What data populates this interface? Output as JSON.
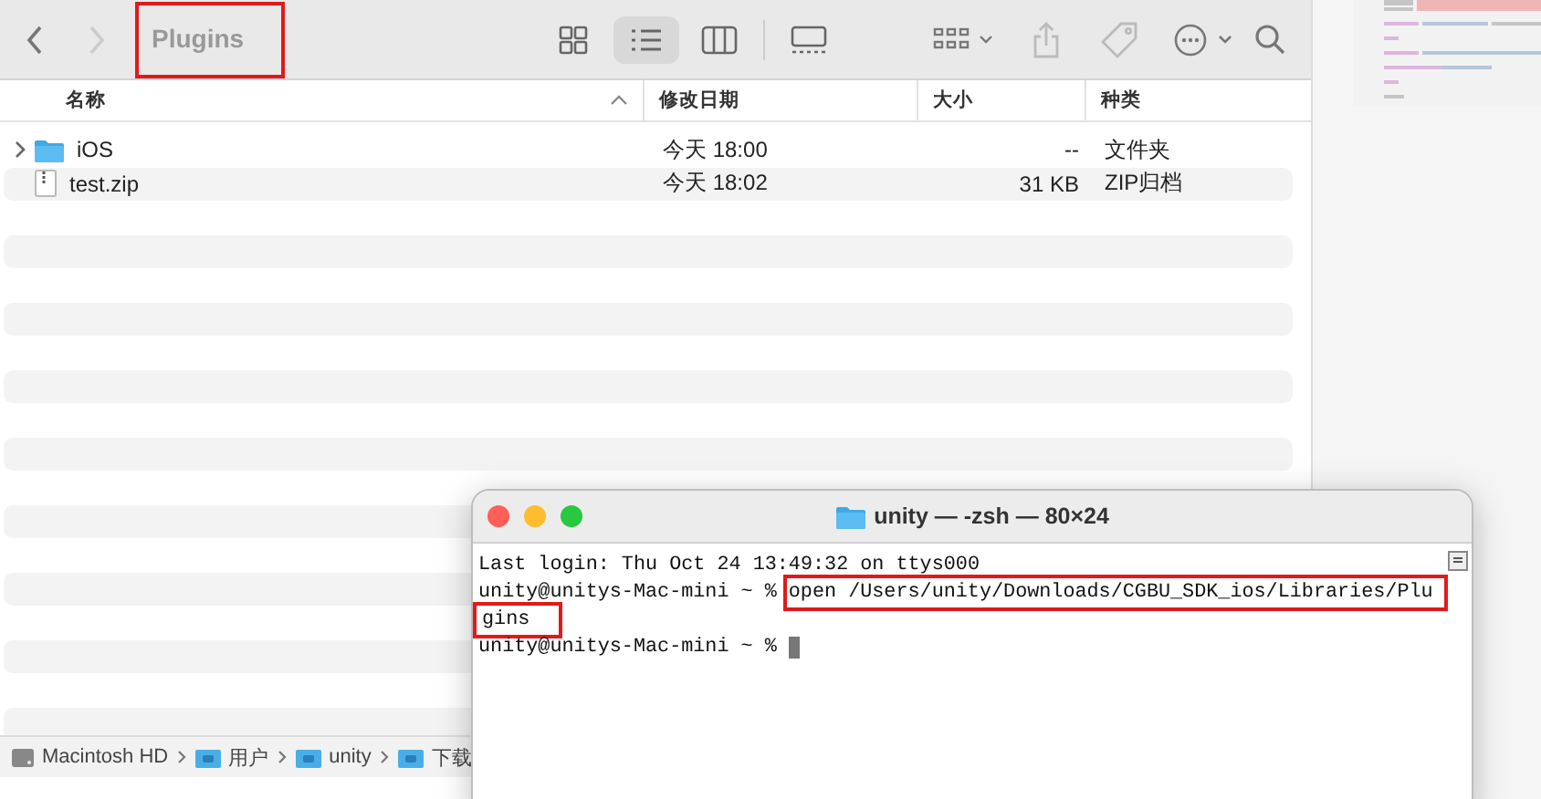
{
  "finder": {
    "title": "Plugins",
    "title_highlighted": true,
    "views": [
      {
        "kind": "grid",
        "selected": false
      },
      {
        "kind": "list",
        "selected": true
      },
      {
        "kind": "columns",
        "selected": false
      },
      {
        "kind": "gallery",
        "selected": false
      }
    ],
    "columns": [
      {
        "label": "名称",
        "sorted": true
      },
      {
        "label": "修改日期",
        "sorted": false
      },
      {
        "label": "大小",
        "sorted": false
      },
      {
        "label": "种类",
        "sorted": false
      }
    ],
    "rows": [
      {
        "kind": "folder",
        "name": "iOS",
        "date": "今天 18:00",
        "size": "--",
        "type": "文件夹",
        "selected": false
      },
      {
        "kind": "file",
        "name": "test.zip",
        "date": "今天 18:02",
        "size": "31 KB",
        "type": "ZIP归档",
        "selected": false
      }
    ],
    "path": [
      {
        "kind": "disk",
        "label": "Macintosh HD"
      },
      {
        "kind": "folder",
        "label": "用户"
      },
      {
        "kind": "folder",
        "label": "unity"
      },
      {
        "kind": "folder",
        "label": "下载"
      }
    ]
  },
  "terminal": {
    "title": "unity — -zsh — 80×24",
    "lines": [
      {
        "kind": "text",
        "text": "Last login: Thu Oct 24 13:49:32 on ttys000"
      },
      {
        "kind": "prompt",
        "prompt": "unity@unitys-Mac-mini ~ %",
        "command": "open /Users/unity/Downloads/CGBU_SDK_ios/Libraries/Plu",
        "highlighted": true
      },
      {
        "kind": "text",
        "text": "gins",
        "highlighted": true
      },
      {
        "kind": "prompt",
        "prompt": "unity@unitys-Mac-mini ~ %",
        "cursor": true
      }
    ]
  }
}
